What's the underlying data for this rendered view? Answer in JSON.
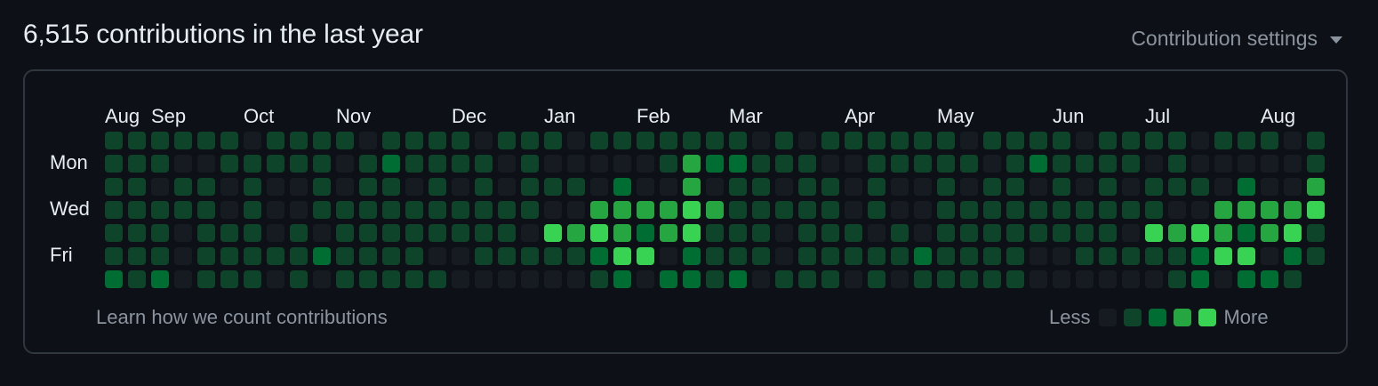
{
  "header": {
    "title": "6,515 contributions in the last year",
    "settings_label": "Contribution settings"
  },
  "months": [
    {
      "label": "Aug",
      "col": 0
    },
    {
      "label": "Sep",
      "col": 2
    },
    {
      "label": "Oct",
      "col": 6
    },
    {
      "label": "Nov",
      "col": 10
    },
    {
      "label": "Dec",
      "col": 15
    },
    {
      "label": "Jan",
      "col": 19
    },
    {
      "label": "Feb",
      "col": 23
    },
    {
      "label": "Mar",
      "col": 27
    },
    {
      "label": "Apr",
      "col": 32
    },
    {
      "label": "May",
      "col": 36
    },
    {
      "label": "Jun",
      "col": 41
    },
    {
      "label": "Jul",
      "col": 45
    },
    {
      "label": "Aug",
      "col": 50
    }
  ],
  "days": {
    "mon": "Mon",
    "wed": "Wed",
    "fri": "Fri"
  },
  "footer": {
    "learn_link": "Learn how we count contributions",
    "less": "Less",
    "more": "More"
  },
  "colors": {
    "level0": "#161b22",
    "level1": "#0e4429",
    "level2": "#006d32",
    "level3": "#26a641",
    "level4": "#39d353"
  },
  "levels": [
    "1111110111101111011101111111010",
    "1110011111012111101000001322",
    "110110100101101010111020030",
    "111110100111111111100333343",
    "11101110101111111104343234",
    "11101111121111001111124402",
    "2120111010111110000001202"
  ]
}
